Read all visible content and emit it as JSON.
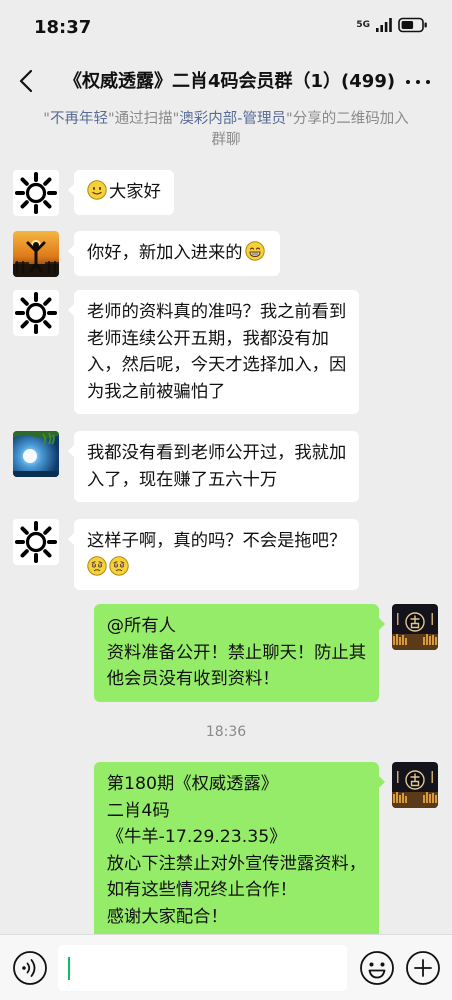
{
  "status": {
    "time": "18:37",
    "network": "5G"
  },
  "header": {
    "title": "《权威透露》二肖4码会员群（1）(499)"
  },
  "system_message": {
    "part1": "\"",
    "inviter": "不再年轻",
    "part2": "\"通过扫描\"",
    "sharer": "澳彩内部-管理员",
    "part3": "\"分享的二维码加入群聊"
  },
  "messages": [
    {
      "sender": "other",
      "lines": [
        "大家好"
      ]
    },
    {
      "sender": "other",
      "lines": [
        "你好，新加入进来的"
      ]
    },
    {
      "sender": "other",
      "lines": [
        "老师的资料真的准吗？我之前看到",
        "老师连续公开五期，我都没有加",
        "入，然后呢，今天才选择加入，因",
        "为我之前被骗怕了"
      ]
    },
    {
      "sender": "other",
      "lines": [
        "我都没有看到老师公开过，我就加",
        "入了，现在赚了五六十万"
      ]
    },
    {
      "sender": "other",
      "lines": [
        "这样子啊，真的吗？不会是拖吧？"
      ]
    },
    {
      "sender": "self",
      "lines": [
        "@所有人",
        "资料准备公开！禁止聊天！防止其",
        "他会员没有收到资料！"
      ]
    },
    {
      "sender": "self",
      "lines": [
        "第180期《权威透露》",
        "二肖4码",
        "《牛羊-17.29.23.35》",
        "放心下注禁止对外宣传泄露资料，",
        "如有这些情况终止合作！",
        "感谢大家配合！"
      ]
    }
  ],
  "time_divider": "18:36",
  "icons": {
    "back": "chevron-left-icon",
    "more": "more-dots-icon",
    "voice": "voice-icon",
    "emoji": "emoji-icon",
    "plus": "plus-icon",
    "smile": "smile-emoji",
    "grin": "grin-emoji",
    "worried": "worried-emoji"
  },
  "colors": {
    "self_bubble": "#95EC69",
    "other_bubble": "#FFFFFF",
    "background": "#EDEDED",
    "link": "#5A6C96",
    "cursor": "#07C160"
  }
}
